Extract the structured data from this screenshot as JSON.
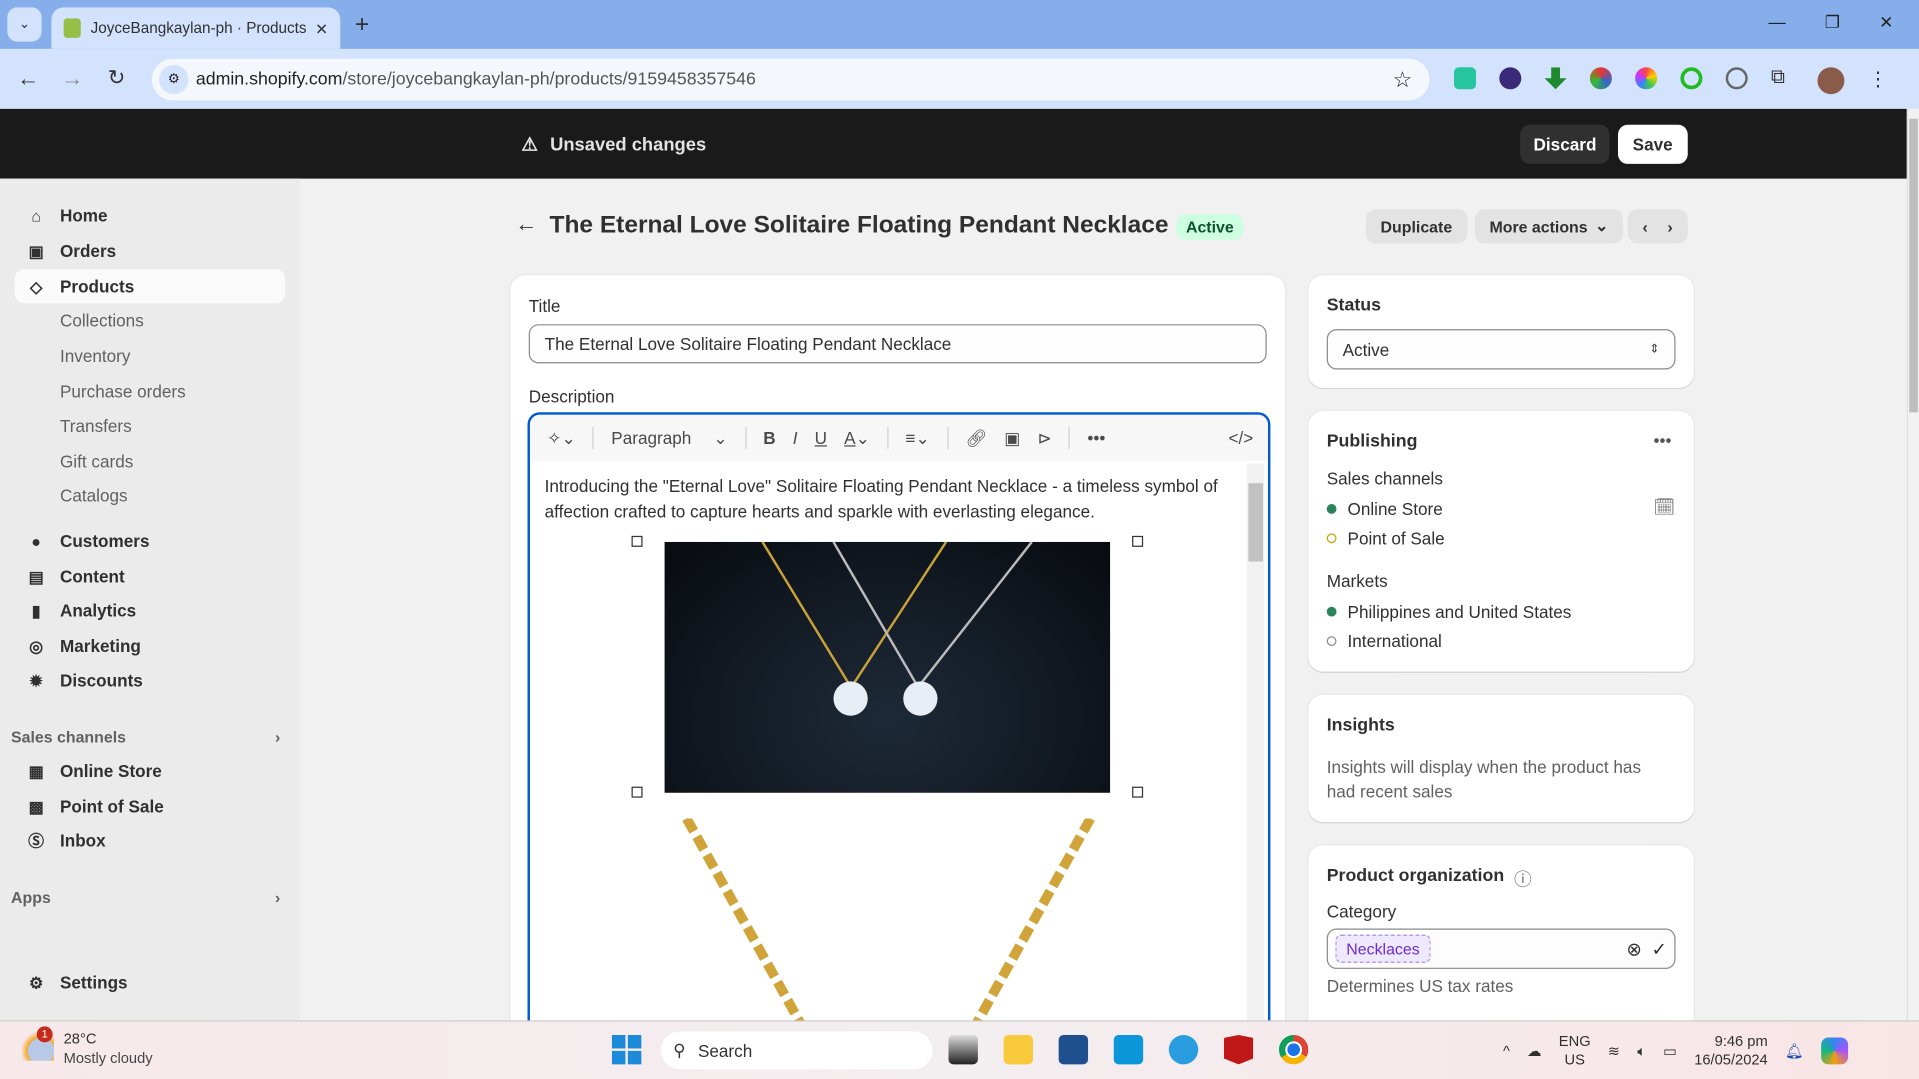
{
  "browser": {
    "tab_title": "JoyceBangkaylan-ph · Products",
    "url_host": "admin.shopify.com",
    "url_path": "/store/joycebangkaylan-ph/products/9159458357546"
  },
  "topbar": {
    "message": "Unsaved changes",
    "discard": "Discard",
    "save": "Save"
  },
  "sidebar": {
    "items": [
      {
        "label": "Home",
        "icon": "home-icon"
      },
      {
        "label": "Orders",
        "icon": "orders-icon"
      },
      {
        "label": "Products",
        "icon": "tag-icon"
      },
      {
        "label": "Collections"
      },
      {
        "label": "Inventory"
      },
      {
        "label": "Purchase orders"
      },
      {
        "label": "Transfers"
      },
      {
        "label": "Gift cards"
      },
      {
        "label": "Catalogs"
      },
      {
        "label": "Customers",
        "icon": "person-icon"
      },
      {
        "label": "Content",
        "icon": "content-icon"
      },
      {
        "label": "Analytics",
        "icon": "bar-chart-icon"
      },
      {
        "label": "Marketing",
        "icon": "target-icon"
      },
      {
        "label": "Discounts",
        "icon": "discount-icon"
      }
    ],
    "sales_channels_heading": "Sales channels",
    "channels": [
      {
        "label": "Online Store"
      },
      {
        "label": "Point of Sale"
      },
      {
        "label": "Inbox"
      }
    ],
    "apps_heading": "Apps",
    "settings": "Settings"
  },
  "page": {
    "title": "The Eternal Love Solitaire Floating Pendant Necklace",
    "badge": "Active",
    "duplicate": "Duplicate",
    "more_actions": "More actions"
  },
  "product": {
    "title_label": "Title",
    "title_value": "The Eternal Love Solitaire Floating Pendant Necklace",
    "description_label": "Description",
    "paragraph_select": "Paragraph",
    "description_text": "Introducing the \"Eternal Love\" Solitaire Floating Pendant Necklace - a timeless symbol of affection crafted to capture hearts and sparkle with everlasting elegance."
  },
  "status": {
    "heading": "Status",
    "value": "Active"
  },
  "publishing": {
    "heading": "Publishing",
    "sales_channels_label": "Sales channels",
    "channels": [
      {
        "label": "Online Store",
        "color": "#29845a"
      },
      {
        "label": "Point of Sale",
        "color": "#c8a000"
      }
    ],
    "markets_label": "Markets",
    "markets": [
      {
        "label": "Philippines and United States",
        "color": "#29845a"
      },
      {
        "label": "International",
        "color": "#8a8a8a"
      }
    ]
  },
  "insights": {
    "heading": "Insights",
    "text": "Insights will display when the product has had recent sales"
  },
  "organization": {
    "heading": "Product organization",
    "category_label": "Category",
    "category_value": "Necklaces",
    "help": "Determines US tax rates"
  },
  "taskbar": {
    "temp": "28°C",
    "weather": "Mostly cloudy",
    "weather_badge": "1",
    "search": "Search",
    "lang1": "ENG",
    "lang2": "US",
    "time": "9:46 pm",
    "date": "16/05/2024"
  }
}
